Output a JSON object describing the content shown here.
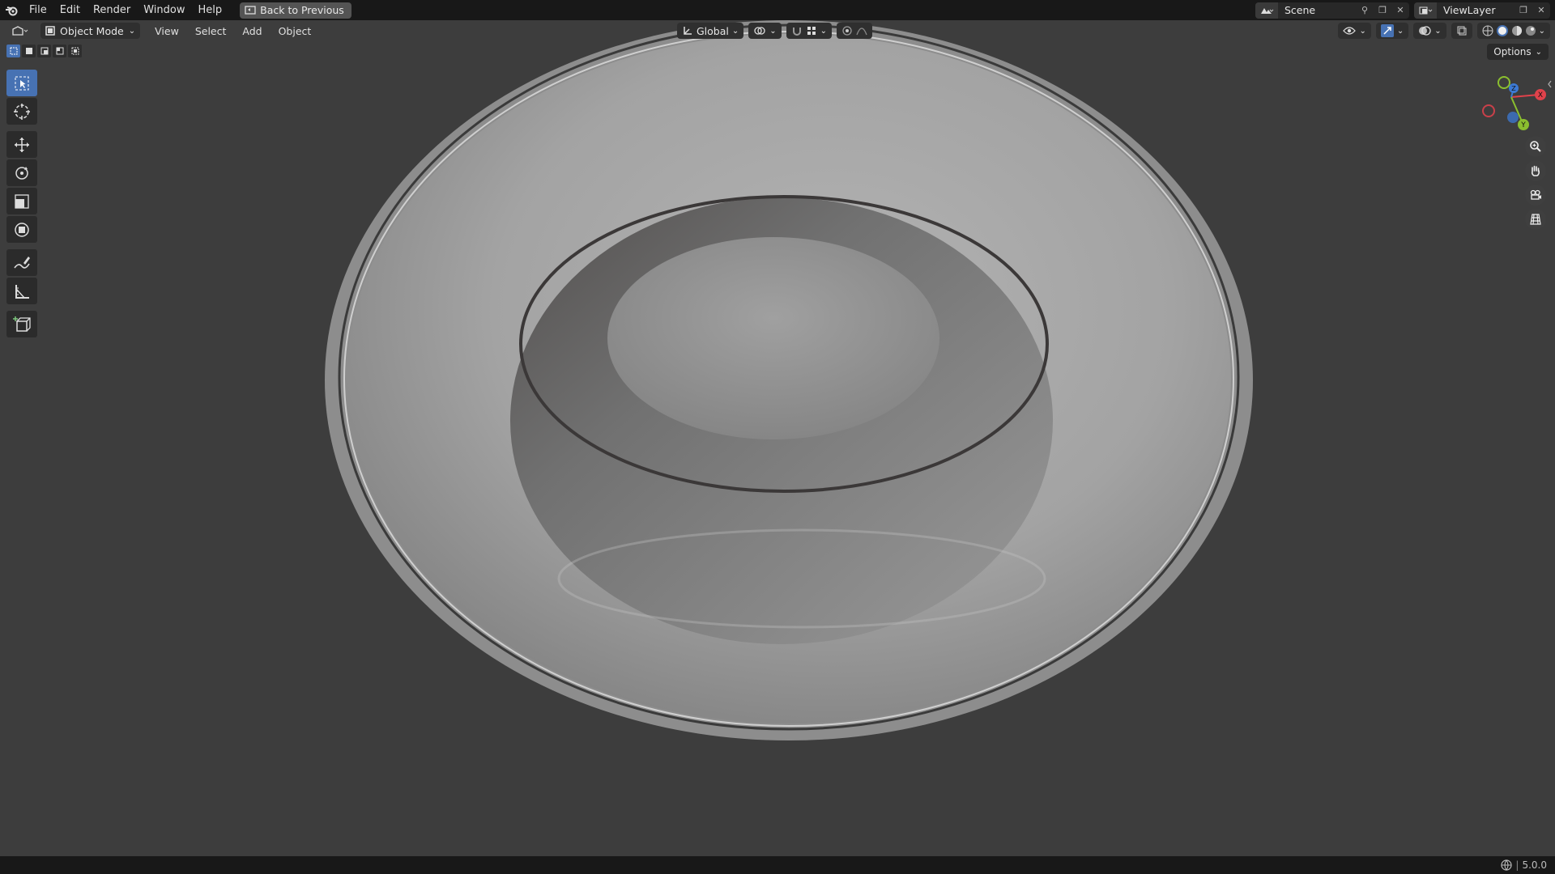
{
  "topbar": {
    "menu": [
      "File",
      "Edit",
      "Render",
      "Window",
      "Help"
    ],
    "back_button": "Back to Previous",
    "scene_name": "Scene",
    "view_layer_name": "ViewLayer"
  },
  "header": {
    "mode": "Object Mode",
    "menu": [
      "View",
      "Select",
      "Add",
      "Object"
    ],
    "transform_orientation": "Global",
    "options_label": "Options"
  },
  "gizmo": {
    "x_label": "X",
    "y_label": "Y",
    "z_label": "Z"
  },
  "status": {
    "version": "5.0.0"
  },
  "colors": {
    "accent": "#4772b3",
    "axis_x": "#e0424b",
    "axis_y": "#8bbf2f",
    "axis_z": "#3c7ad4",
    "background": "#3d3d3d"
  }
}
